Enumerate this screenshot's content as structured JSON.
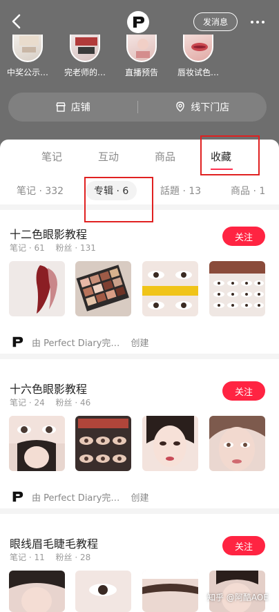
{
  "header": {
    "message_button": "发消息",
    "stories": [
      {
        "label": "中奖公示…",
        "icon": "story-thumb-1"
      },
      {
        "label": "完老师的…",
        "icon": "story-thumb-2"
      },
      {
        "label": "直播预告",
        "icon": "story-thumb-3"
      },
      {
        "label": "唇妆试色…",
        "icon": "story-thumb-4"
      }
    ],
    "store_bar": {
      "store_label": "店铺",
      "offline_label": "线下门店"
    }
  },
  "tabs": [
    {
      "label": "笔记",
      "active": false
    },
    {
      "label": "互动",
      "active": false
    },
    {
      "label": "商品",
      "active": false
    },
    {
      "label": "收藏",
      "active": true
    }
  ],
  "subtabs": [
    {
      "label": "笔记 · 332",
      "active": false
    },
    {
      "label": "专辑 · 6",
      "active": true
    },
    {
      "label": "話題 · 13",
      "active": false
    },
    {
      "label": "商品 · 1",
      "active": false
    }
  ],
  "albums": [
    {
      "title": "十二色眼影教程",
      "notes": "笔记 · 61",
      "fans": "粉丝 · 131",
      "follow": "关注",
      "creator": "由 Perfect Diary完…",
      "created": "创建"
    },
    {
      "title": "十六色眼影教程",
      "notes": "笔记 · 24",
      "fans": "粉丝 · 46",
      "follow": "关注",
      "creator": "由 Perfect Diary完…",
      "created": "创建"
    },
    {
      "title": "眼线眉毛睫毛教程",
      "notes": "笔记 · 11",
      "fans": "粉丝 · 28",
      "follow": "关注"
    }
  ],
  "watermark": "知乎 @阿酷AOE",
  "colors": {
    "accent": "#ff2442",
    "header_bg": "#6e6e6e",
    "annotation": "#e02020"
  }
}
